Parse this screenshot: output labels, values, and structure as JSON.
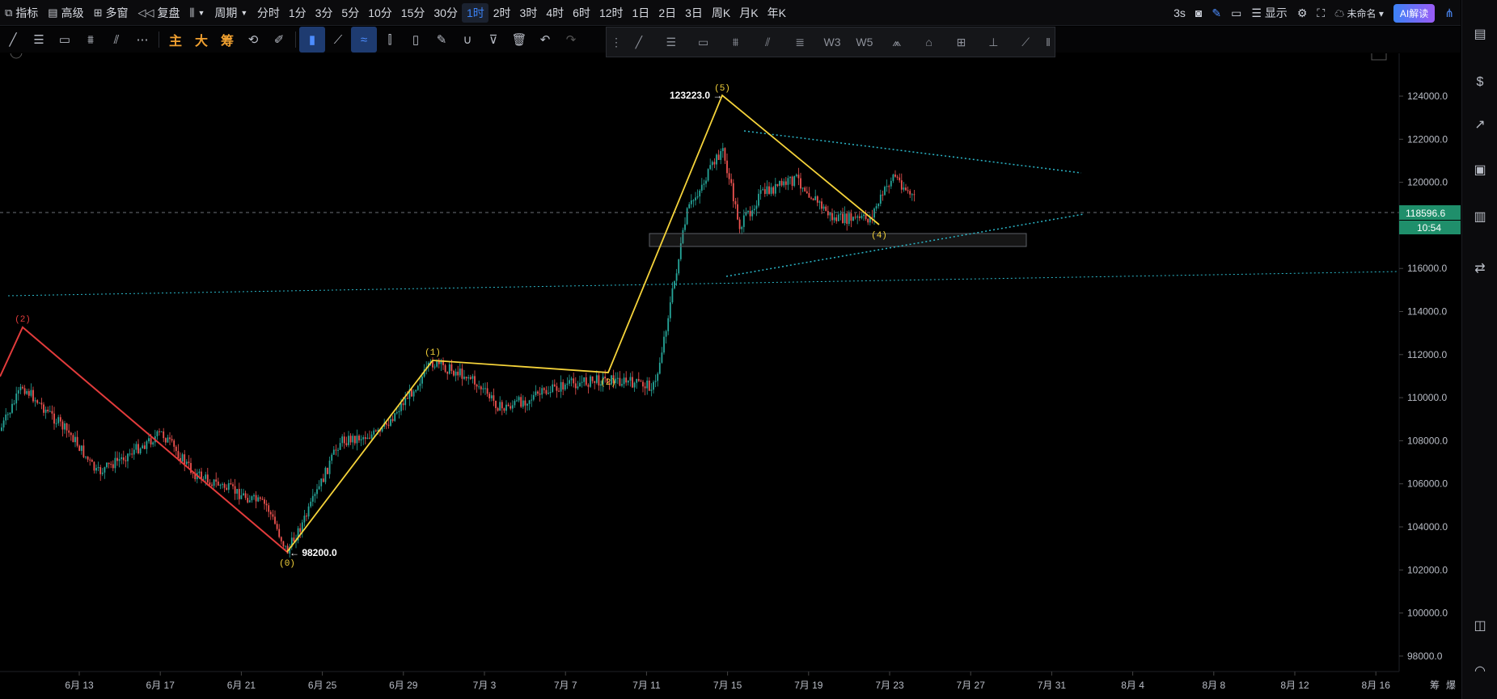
{
  "topbar": {
    "indicator": "指标",
    "advanced": "高级",
    "multi": "多窗",
    "replay": "复盘",
    "period": "周期",
    "timeframes": [
      "分时",
      "1分",
      "3分",
      "5分",
      "10分",
      "15分",
      "30分",
      "1时",
      "2时",
      "3时",
      "4时",
      "6时",
      "12时",
      "1日",
      "2日",
      "3日",
      "周K",
      "月K",
      "年K"
    ],
    "active_timeframe": "1时",
    "refresh": "3s",
    "display": "显示",
    "unnamed": "未命名",
    "ai": "AI解读"
  },
  "toolbar2": {
    "zhu": "主",
    "da": "大",
    "chou": "筹"
  },
  "colors": {
    "up": "#26a69a",
    "down": "#ef5350",
    "wave": "#f5d33a",
    "red_wave": "#e23b3b",
    "channel": "#2bb6c8",
    "price_tag": "#1f8f6b"
  },
  "chart_data": {
    "type": "candlestick",
    "y_axis": [
      "124000.0",
      "122000.0",
      "120000.0",
      "118000.0",
      "116000.0",
      "114000.0",
      "112000.0",
      "110000.0",
      "108000.0",
      "106000.0",
      "104000.0",
      "102000.0",
      "100000.0",
      "98000.0"
    ],
    "x_axis": [
      "6月 13",
      "6月 17",
      "6月 21",
      "6月 25",
      "6月 29",
      "7月 3",
      "7月 7",
      "7月 11",
      "7月 15",
      "7月 19",
      "7月 23",
      "7月 27",
      "7月 31",
      "8月 4",
      "8月 8",
      "8月 12",
      "8月 16"
    ],
    "current_price": "118596.6",
    "countdown": "10:54",
    "high_label": "123223.0",
    "low_label": "98200.0",
    "wave_labels": [
      "(2)",
      "(0)",
      "(1)",
      "(2)",
      "(5)",
      "(4)"
    ],
    "corner_labels": [
      "筹",
      "爆"
    ]
  }
}
